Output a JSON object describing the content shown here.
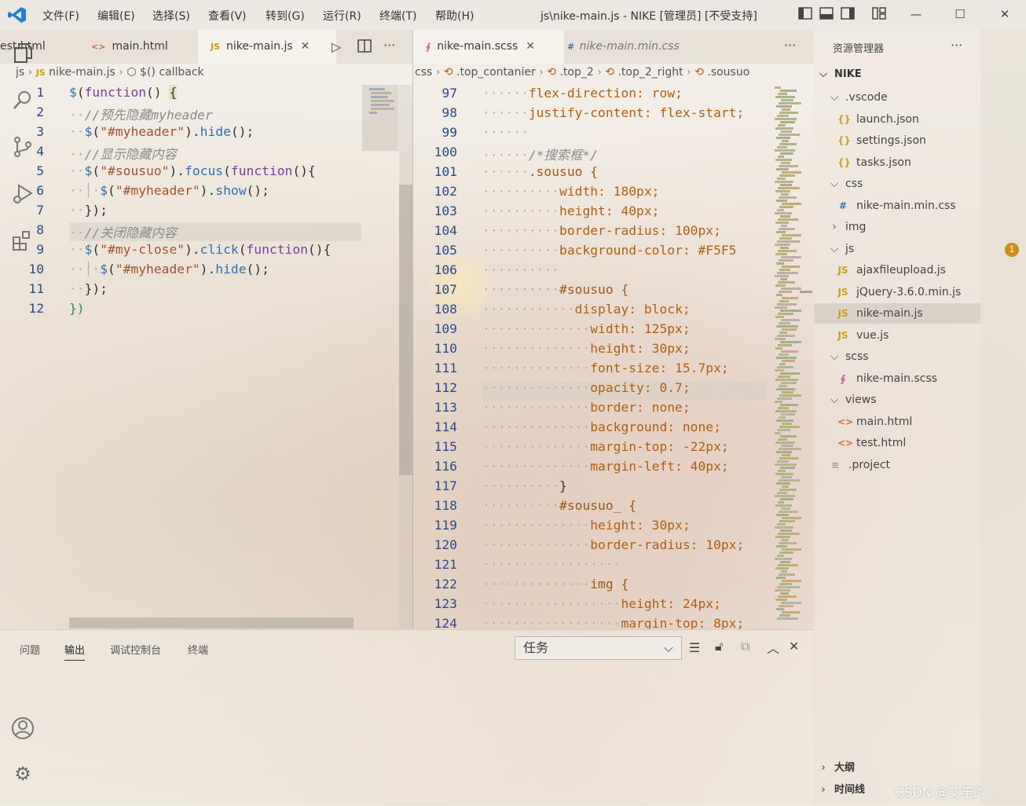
{
  "window": {
    "title": "js\\nike-main.js - NIKE [管理员] [不受支持]",
    "menus": [
      "文件(F)",
      "编辑(E)",
      "选择(S)",
      "查看(V)",
      "转到(G)",
      "运行(R)",
      "终端(T)",
      "帮助(H)"
    ],
    "buttons": {
      "minimize": "—",
      "maximize": "☐",
      "close": "✕"
    }
  },
  "left_editor": {
    "tabs": [
      {
        "label": "est.html",
        "icon": "html-file-icon"
      },
      {
        "label": "main.html",
        "icon": "html-file-icon"
      },
      {
        "label": "nike-main.js",
        "icon": "js-file-icon",
        "active": true
      }
    ],
    "breadcrumb": [
      "js",
      "nike-main.js",
      "$() callback"
    ],
    "lines": [
      {
        "n": "1",
        "text": "$(function() {"
      },
      {
        "n": "2",
        "text": "  //预先隐藏myheader"
      },
      {
        "n": "3",
        "text": "  $(\"#myheader\").hide();"
      },
      {
        "n": "4",
        "text": "  //显示隐藏内容"
      },
      {
        "n": "5",
        "text": "  $(\"#sousuo\").focus(function(){"
      },
      {
        "n": "6",
        "text": "    $(\"#myheader\").show();"
      },
      {
        "n": "7",
        "text": "  });"
      },
      {
        "n": "8",
        "text": "  //关闭隐藏内容"
      },
      {
        "n": "9",
        "text": "  $(\"#my-close\").click(function(){"
      },
      {
        "n": "10",
        "text": "    $(\"#myheader\").hide();"
      },
      {
        "n": "11",
        "text": "  });"
      },
      {
        "n": "12",
        "text": "})"
      }
    ]
  },
  "right_editor": {
    "tabs": [
      {
        "label": "nike-main.scss",
        "icon": "scss-file-icon",
        "active": true
      },
      {
        "label": "nike-main.min.css",
        "icon": "css-file-icon"
      }
    ],
    "breadcrumb": [
      "css",
      "top_contanier",
      "top_2",
      "top_2_right",
      "sousuo"
    ],
    "lines": [
      {
        "n": "97",
        "text": "flex-direction: row;"
      },
      {
        "n": "98",
        "text": "justify-content: flex-start;"
      },
      {
        "n": "99",
        "text": ""
      },
      {
        "n": "100",
        "text": "/*搜索框*/"
      },
      {
        "n": "101",
        "text": ".sousuo {"
      },
      {
        "n": "102",
        "text": "width: 180px;"
      },
      {
        "n": "103",
        "text": "height: 40px;"
      },
      {
        "n": "104",
        "text": "border-radius: 100px;"
      },
      {
        "n": "105",
        "text": "background-color: #F5F5"
      },
      {
        "n": "106",
        "text": ""
      },
      {
        "n": "107",
        "text": "#sousuo {"
      },
      {
        "n": "108",
        "text": "display: block;"
      },
      {
        "n": "109",
        "text": "width: 125px;"
      },
      {
        "n": "110",
        "text": "height: 30px;"
      },
      {
        "n": "111",
        "text": "font-size: 15.7px;"
      },
      {
        "n": "112",
        "text": "opacity: 0.7;"
      },
      {
        "n": "113",
        "text": "border: none;"
      },
      {
        "n": "114",
        "text": "background: none;"
      },
      {
        "n": "115",
        "text": "margin-top: -22px;"
      },
      {
        "n": "116",
        "text": "margin-left: 40px;"
      },
      {
        "n": "117",
        "text": "}"
      },
      {
        "n": "118",
        "text": "#sousuo_ {"
      },
      {
        "n": "119",
        "text": "height: 30px;"
      },
      {
        "n": "120",
        "text": "border-radius: 10px;"
      },
      {
        "n": "121",
        "text": ""
      },
      {
        "n": "122",
        "text": "img {"
      },
      {
        "n": "123",
        "text": "height: 24px;"
      },
      {
        "n": "124",
        "text": "margin-top: 8px;"
      }
    ]
  },
  "explorer": {
    "title": "资源管理器",
    "more": "···",
    "root": "NIKE",
    "items": [
      {
        "label": ".vscode",
        "type": "folder",
        "depth": 1
      },
      {
        "label": "launch.json",
        "type": "json",
        "depth": 2
      },
      {
        "label": "settings.json",
        "type": "json",
        "depth": 2
      },
      {
        "label": "tasks.json",
        "type": "json",
        "depth": 2
      },
      {
        "label": "css",
        "type": "folder",
        "depth": 1
      },
      {
        "label": "nike-main.min.css",
        "type": "css",
        "depth": 2
      },
      {
        "label": "img",
        "type": "folder-closed",
        "depth": 1
      },
      {
        "label": "js",
        "type": "folder",
        "depth": 1
      },
      {
        "label": "ajaxfileupload.js",
        "type": "js",
        "depth": 2
      },
      {
        "label": "jQuery-3.6.0.min.js",
        "type": "js",
        "depth": 2
      },
      {
        "label": "nike-main.js",
        "type": "js",
        "depth": 2,
        "selected": true
      },
      {
        "label": "vue.js",
        "type": "js",
        "depth": 2
      },
      {
        "label": "scss",
        "type": "folder",
        "depth": 1
      },
      {
        "label": "nike-main.scss",
        "type": "scss",
        "depth": 2
      },
      {
        "label": "views",
        "type": "folder",
        "depth": 1
      },
      {
        "label": "main.html",
        "type": "html",
        "depth": 2
      },
      {
        "label": "test.html",
        "type": "html",
        "depth": 2
      },
      {
        "label": ".project",
        "type": "file",
        "depth": 1
      }
    ],
    "outline": "大纲",
    "timeline": "时间线"
  },
  "activity": {
    "extensions_badge": "1"
  },
  "panel": {
    "tabs": [
      "问题",
      "输出",
      "调试控制台",
      "终端"
    ],
    "active_tab": "输出",
    "dropdown_value": "任务"
  },
  "watermark": "CSDN @艾笙的猫."
}
